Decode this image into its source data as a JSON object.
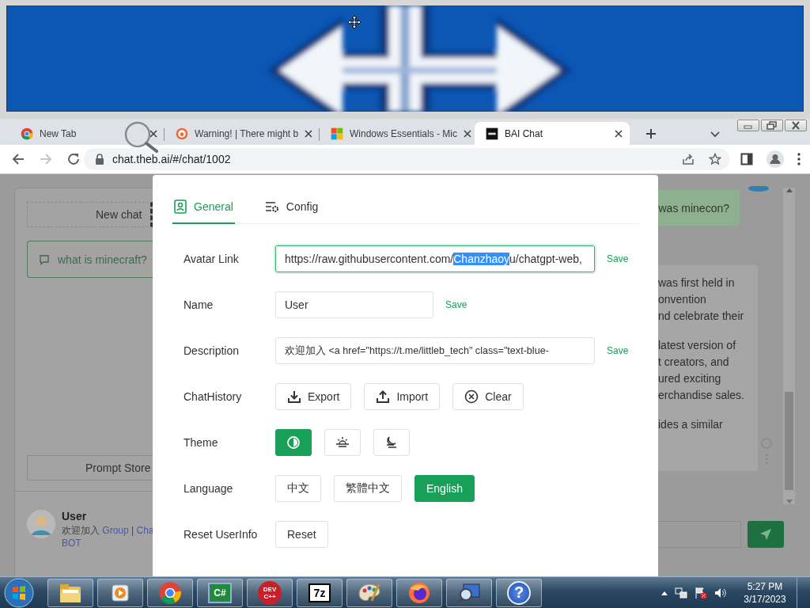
{
  "browser": {
    "tabs": [
      {
        "title": "New Tab",
        "kind": "chrome",
        "selected": false
      },
      {
        "title": "Warning! | There might b",
        "kind": "brave",
        "selected": false
      },
      {
        "title": "Windows Essentials - Mic",
        "kind": "windows",
        "selected": false
      },
      {
        "title": "BAI Chat",
        "kind": "bai",
        "selected": true
      }
    ],
    "url": "chat.theb.ai/#/chat/1002"
  },
  "sidebar": {
    "new_chat": "New chat",
    "chats": [
      {
        "title": "what is minecraft?",
        "selected": true
      }
    ],
    "prompt_store": "Prompt Store",
    "user": {
      "name": "User",
      "description": [
        [
          {
            "kind": "text",
            "text": "欢迎加入"
          },
          {
            "kind": "link",
            "text": "Group"
          },
          {
            "kind": "text",
            "text": "|"
          },
          {
            "kind": "link",
            "text": "Cha"
          }
        ],
        [
          {
            "kind": "link",
            "text": "BOT"
          }
        ]
      ]
    }
  },
  "chat": {
    "user_message": "was minecon?",
    "reply_paragraphs": [
      [
        "was first held in",
        "onvention",
        "nd celebrate their"
      ],
      [
        "latest version of",
        "t creators, and",
        "ured exciting",
        "erchandise sales."
      ],
      [
        "ides a similar"
      ]
    ]
  },
  "settings": {
    "tabs": [
      {
        "label": "General",
        "kind": "user",
        "selected": true
      },
      {
        "label": "Config",
        "kind": "config",
        "selected": false
      }
    ],
    "rows": [
      {
        "kind": "field",
        "label": "Avatar Link",
        "focused": true,
        "value": [
          "https://raw.githubusercontent.com/",
          "Chanzhaoy",
          "u/chatgpt-web,"
        ],
        "action": "Save"
      },
      {
        "kind": "short",
        "label": "Name",
        "focused": false,
        "value": [
          "User"
        ],
        "action": "Save"
      },
      {
        "kind": "field",
        "label": "Description",
        "focused": false,
        "value": [
          "欢迎加入 <a href=\"https://t.me/littleb_tech\" class=\"text-blue-"
        ],
        "action": "Save"
      },
      {
        "kind": "buttons",
        "label": "ChatHistory",
        "buttons": [
          {
            "label": "Export",
            "kind": "download"
          },
          {
            "label": "Import",
            "kind": "upload"
          },
          {
            "label": "Clear",
            "kind": "clear"
          }
        ]
      },
      {
        "kind": "choices",
        "label": "Theme",
        "options": [
          {
            "kind": "auto",
            "selected": true
          },
          {
            "kind": "light",
            "selected": false
          },
          {
            "kind": "dark",
            "selected": false
          }
        ]
      },
      {
        "kind": "choices",
        "label": "Language",
        "options": [
          {
            "kind": "text",
            "label": "中文",
            "selected": false
          },
          {
            "kind": "text",
            "label": "繁體中文",
            "selected": false
          },
          {
            "kind": "text",
            "label": "English",
            "selected": true
          }
        ]
      },
      {
        "kind": "buttons",
        "label": "Reset UserInfo",
        "buttons": [
          {
            "kind": "text",
            "label": "Reset"
          }
        ]
      }
    ]
  },
  "taskbar": {
    "apps": [
      {
        "kind": "folder"
      },
      {
        "kind": "media"
      },
      {
        "kind": "chrome"
      },
      {
        "kind": "csharp",
        "glyph": "C#"
      },
      {
        "kind": "devcpp",
        "glyph": "DEV C++"
      },
      {
        "kind": "sevenzip",
        "glyph": "7z"
      },
      {
        "kind": "paint"
      },
      {
        "kind": "firefox"
      },
      {
        "kind": "magnifier"
      },
      {
        "kind": "help",
        "glyph": "?"
      }
    ],
    "time": "5:27 PM",
    "date": "3/17/2023"
  }
}
